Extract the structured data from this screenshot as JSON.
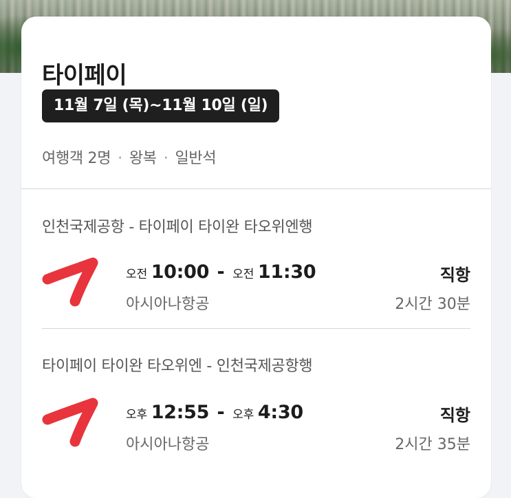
{
  "destination": "타이페이",
  "date_range": "11월 7일 (목)~11월 10일 (일)",
  "trip_meta": {
    "travelers": "여행객 2명",
    "trip_type": "왕복",
    "cabin": "일반석",
    "separator": "·"
  },
  "flights": [
    {
      "route": "인천국제공항 - 타이페이 타이완 타오위엔행",
      "depart_period": "오전",
      "depart_time": "10:00",
      "dash": "-",
      "arrive_period": "오전",
      "arrive_time": "11:30",
      "airline": "아시아나항공",
      "stop_type": "직항",
      "duration": "2시간 30분",
      "logo_icon": "airline-swoosh-icon",
      "logo_color": "#e8343c"
    },
    {
      "route": "타이페이 타이완 타오위엔 - 인천국제공항행",
      "depart_period": "오후",
      "depart_time": "12:55",
      "dash": "-",
      "arrive_period": "오후",
      "arrive_time": "4:30",
      "airline": "아시아나항공",
      "stop_type": "직항",
      "duration": "2시간 35분",
      "logo_icon": "airline-swoosh-icon",
      "logo_color": "#e8343c"
    }
  ]
}
